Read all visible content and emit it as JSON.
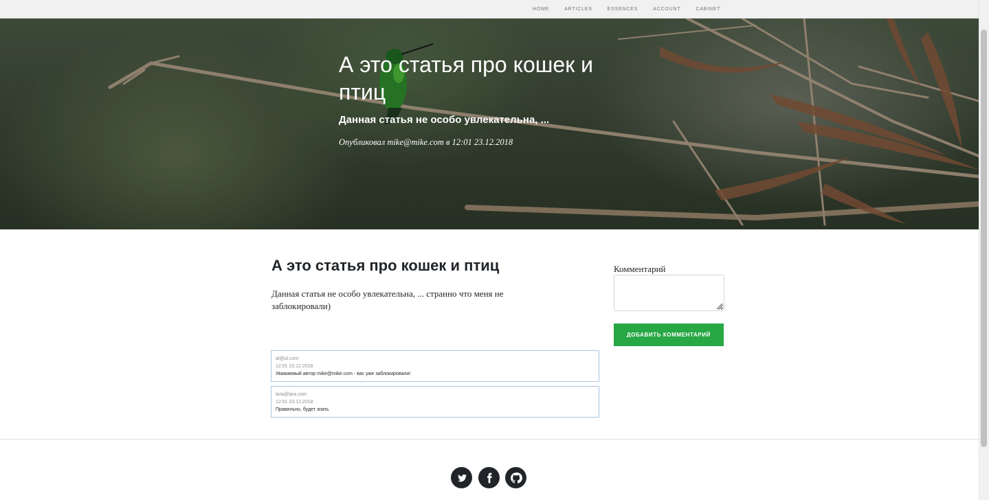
{
  "nav": {
    "items": [
      "HOME",
      "ARTICLES",
      "ESSENCES",
      "ACCOUNT",
      "CABINET"
    ]
  },
  "hero": {
    "title": "А это статья про кошек и птиц",
    "subtitle": "Данная статья не особо увлекательна, ...",
    "meta": "Опубликовал mike@mike.com в 12:01 23.12.2018"
  },
  "article": {
    "title": "А это статья про кошек и птиц",
    "body": "Данная статья не особо увлекательна, ... странно что меня не заблокировали)"
  },
  "comments": [
    {
      "author": "al@al.com",
      "date": "12:01 23.12.2018",
      "text": "Уважаемый автор mike@mike.com - вас уже заблокировали!"
    },
    {
      "author": "lara@lara.com",
      "date": "12:01 23.12.2018",
      "text": "Правильно, будет знать"
    }
  ],
  "form": {
    "label": "Комментарий",
    "button": "Добавить комментарий"
  },
  "footer": {
    "icons": [
      "twitter-icon",
      "facebook-icon",
      "github-icon"
    ]
  },
  "colors": {
    "accent": "#28a745",
    "comment_border": "#a8c5e3",
    "dark": "#212529"
  }
}
